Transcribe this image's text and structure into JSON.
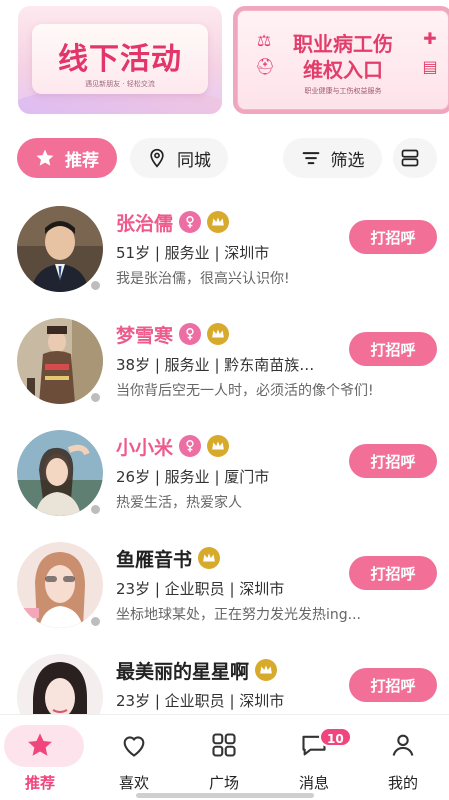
{
  "banners": {
    "left": {
      "title": "线下活动",
      "subtitle": "遇见新朋友 · 轻松交流"
    },
    "right": {
      "line1": "职业病工伤",
      "line2": "维权入口",
      "subtitle": "职业健康与工伤权益服务"
    }
  },
  "filters": {
    "recommend": "推荐",
    "same_city": "同城",
    "filter": "筛选"
  },
  "users": [
    {
      "name": "张治儒",
      "name_color": "pink",
      "gender_badge": true,
      "meta": "51岁 | 服务业 | 深圳市",
      "bio": "我是张治儒，很高兴认识你!",
      "action": "打招呼"
    },
    {
      "name": "梦雪寒",
      "name_color": "pink",
      "gender_badge": true,
      "meta": "38岁 | 服务业 | 黔东南苗族…",
      "bio": "当你背后空无一人时，必须活的像个爷们!",
      "action": "打招呼"
    },
    {
      "name": "小小米",
      "name_color": "pink",
      "gender_badge": true,
      "meta": "26岁 | 服务业 | 厦门市",
      "bio": "热爱生活，热爱家人",
      "action": "打招呼"
    },
    {
      "name": "鱼雁音书",
      "name_color": "dark",
      "gender_badge": false,
      "meta": "23岁 | 企业职员 | 深圳市",
      "bio": "坐标地球某处，正在努力发光发热ing...",
      "action": "打招呼"
    },
    {
      "name": "最美丽的星星啊",
      "name_color": "dark",
      "gender_badge": false,
      "meta": "23岁 | 企业职员 | 深圳市",
      "bio": "",
      "action": "打招呼"
    }
  ],
  "nav": {
    "items": [
      {
        "label": "推荐",
        "icon": "star-icon",
        "active": true
      },
      {
        "label": "喜欢",
        "icon": "heart-icon",
        "active": false
      },
      {
        "label": "广场",
        "icon": "grid-icon",
        "active": false
      },
      {
        "label": "消息",
        "icon": "chat-icon",
        "active": false,
        "badge": "10"
      },
      {
        "label": "我的",
        "icon": "person-icon",
        "active": false
      }
    ]
  },
  "colors": {
    "accent": "#f26f97",
    "name_pink": "#ee5a8c",
    "crown": "#d8aa2b",
    "gender": "#ec6ea2"
  }
}
